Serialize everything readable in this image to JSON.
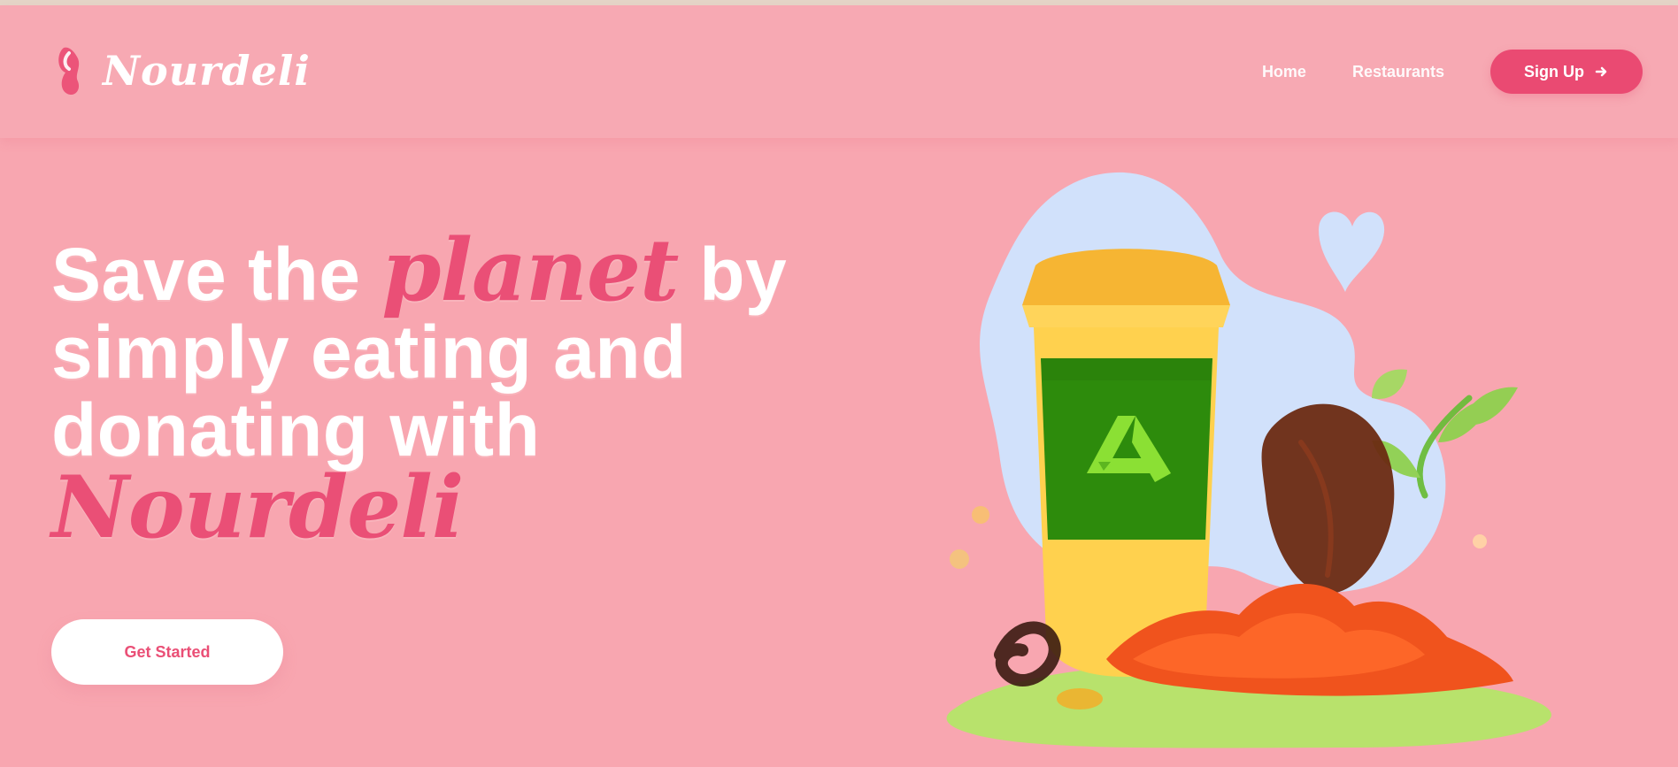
{
  "colors": {
    "background": "#f8a6b0",
    "accent": "#ea4a72",
    "text_on_bg": "#ffffff"
  },
  "header": {
    "brand": "Nourdeli",
    "nav": [
      {
        "label": "Home"
      },
      {
        "label": "Restaurants"
      }
    ],
    "cta_label": "Sign Up"
  },
  "hero": {
    "headline_part1": "Save the ",
    "headline_accent": "planet",
    "headline_part2": " by simply eating and donating with ",
    "headline_brand": "Nourdeli",
    "cta_label": "Get Started"
  }
}
